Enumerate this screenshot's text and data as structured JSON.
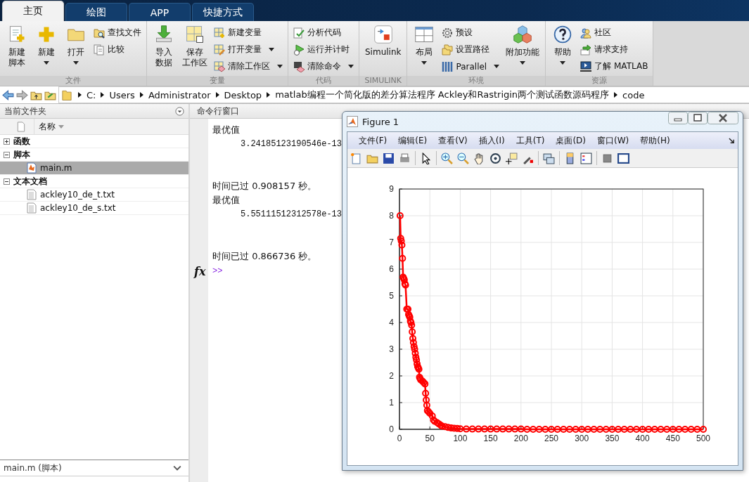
{
  "tabs": [
    {
      "label": "主页",
      "selected": true
    },
    {
      "label": "绘图",
      "selected": false
    },
    {
      "label": "APP",
      "selected": false
    },
    {
      "label": "快捷方式",
      "selected": false
    }
  ],
  "ribbon": {
    "groups": [
      {
        "label": "文件",
        "columns": [
          [
            {
              "kind": "large",
              "lines": [
                "新建",
                "脚本"
              ],
              "dropdown": false
            }
          ],
          [
            {
              "kind": "large",
              "lines": [
                "新建"
              ],
              "dropdown": true
            }
          ],
          [
            {
              "kind": "large",
              "lines": [
                "打开"
              ],
              "dropdown": true
            }
          ],
          [
            {
              "kind": "small",
              "lines": [
                "查找文件"
              ],
              "dropdown": false
            },
            {
              "kind": "small",
              "lines": [
                "比较"
              ],
              "dropdown": false
            }
          ]
        ]
      },
      {
        "label": "变量",
        "columns": [
          [
            {
              "kind": "large",
              "lines": [
                "导入",
                "数据"
              ],
              "dropdown": false
            }
          ],
          [
            {
              "kind": "large",
              "lines": [
                "保存",
                "工作区"
              ],
              "dropdown": false
            }
          ],
          [
            {
              "kind": "small",
              "lines": [
                "新建变量"
              ],
              "dropdown": false
            },
            {
              "kind": "small",
              "lines": [
                "打开变量"
              ],
              "dropdown": true
            },
            {
              "kind": "small",
              "lines": [
                "清除工作区"
              ],
              "dropdown": true
            }
          ]
        ]
      },
      {
        "label": "代码",
        "columns": [
          [
            {
              "kind": "small",
              "lines": [
                "分析代码"
              ],
              "dropdown": false
            },
            {
              "kind": "small",
              "lines": [
                "运行并计时"
              ],
              "dropdown": false
            },
            {
              "kind": "small",
              "lines": [
                "清除命令"
              ],
              "dropdown": true
            }
          ]
        ]
      },
      {
        "label": "SIMULINK",
        "columns": [
          [
            {
              "kind": "large",
              "lines": [
                "Simulink"
              ],
              "dropdown": false
            }
          ]
        ]
      },
      {
        "label": "环境",
        "columns": [
          [
            {
              "kind": "large",
              "lines": [
                "布局"
              ],
              "dropdown": true
            }
          ],
          [
            {
              "kind": "small",
              "lines": [
                "预设"
              ],
              "dropdown": false
            },
            {
              "kind": "small",
              "lines": [
                "设置路径"
              ],
              "dropdown": false
            },
            {
              "kind": "small",
              "lines": [
                "Parallel"
              ],
              "dropdown": true
            }
          ],
          [
            {
              "kind": "large",
              "lines": [
                "附加功能"
              ],
              "dropdown": true
            }
          ]
        ]
      },
      {
        "label": "资源",
        "columns": [
          [
            {
              "kind": "large",
              "lines": [
                "帮助"
              ],
              "dropdown": true
            }
          ],
          [
            {
              "kind": "small",
              "lines": [
                "社区"
              ],
              "dropdown": false
            },
            {
              "kind": "small",
              "lines": [
                "请求支持"
              ],
              "dropdown": false
            },
            {
              "kind": "small",
              "lines": [
                "了解 MATLAB"
              ],
              "dropdown": false
            }
          ]
        ]
      }
    ]
  },
  "address_bar": {
    "crumbs": [
      "C:",
      "Users",
      "Administrator",
      "Desktop",
      "matlab编程一个简化版的差分算法程序 Ackley和Rastrigin两个测试函数源码程序",
      "code"
    ]
  },
  "file_panel": {
    "title": "当前文件夹",
    "column": "名称",
    "tree": [
      {
        "label": "函数",
        "kind": "folder",
        "expanded": false,
        "selected": false
      },
      {
        "label": "脚本",
        "kind": "folder",
        "expanded": true,
        "selected": false,
        "children": [
          {
            "label": "main.m",
            "kind": "mfile",
            "selected": true
          }
        ]
      },
      {
        "label": "文本文档",
        "kind": "folder",
        "expanded": true,
        "selected": false,
        "children": [
          {
            "label": "ackley10_de_t.txt",
            "kind": "text",
            "selected": false
          },
          {
            "label": "ackley10_de_s.txt",
            "kind": "text",
            "selected": false
          }
        ]
      }
    ],
    "details": "main.m  (脚本)"
  },
  "command_window": {
    "title": "命令行窗口",
    "lines": [
      {
        "kind": "label",
        "text": "最优值"
      },
      {
        "kind": "value",
        "text": "3.24185123190546e-13"
      },
      {
        "kind": "blank"
      },
      {
        "kind": "blank"
      },
      {
        "kind": "label",
        "text": "时间已过 0.908157 秒。"
      },
      {
        "kind": "label",
        "text": "最优值"
      },
      {
        "kind": "value",
        "text": "5.55111512312578e-13"
      },
      {
        "kind": "blank"
      },
      {
        "kind": "blank"
      },
      {
        "kind": "label",
        "text": "时间已过 0.866736 秒。"
      }
    ],
    "fx": "fx",
    "prompt": ">>"
  },
  "figure": {
    "title": "Figure 1",
    "menu": [
      "文件(F)",
      "编辑(E)",
      "查看(V)",
      "插入(I)",
      "工具(T)",
      "桌面(D)",
      "窗口(W)",
      "帮助(H)"
    ],
    "chart_data": {
      "type": "line",
      "x": [
        1,
        2,
        3,
        4,
        5,
        6,
        7,
        8,
        9,
        10,
        12,
        14,
        15,
        16,
        17,
        18,
        19,
        20,
        21,
        22,
        23,
        24,
        25,
        26,
        27,
        28,
        29,
        30,
        31,
        32,
        33,
        34,
        35,
        38,
        40,
        42,
        43,
        44,
        45,
        46,
        48,
        50,
        54,
        56,
        58,
        62,
        65,
        68,
        70,
        75,
        80,
        85,
        90,
        95,
        100,
        110,
        120,
        130,
        140,
        150,
        160,
        170,
        180,
        190,
        200,
        210,
        220,
        230,
        240,
        250,
        260,
        270,
        280,
        290,
        300,
        310,
        320,
        330,
        340,
        350,
        360,
        370,
        380,
        390,
        400,
        410,
        420,
        430,
        440,
        450,
        460,
        470,
        480,
        490,
        500
      ],
      "grid": true,
      "series": [
        {
          "color": "#ff0000",
          "marker": "o",
          "values": [
            8.0,
            7.15,
            7.05,
            6.9,
            6.4,
            5.7,
            5.65,
            5.6,
            5.45,
            5.4,
            4.5,
            4.5,
            4.3,
            4.25,
            4.2,
            4.05,
            4.0,
            3.9,
            3.65,
            3.4,
            3.25,
            3.1,
            3.0,
            2.85,
            2.7,
            2.6,
            2.45,
            2.35,
            2.3,
            2.25,
            1.95,
            1.9,
            1.85,
            1.8,
            1.75,
            1.7,
            1.35,
            1.1,
            0.9,
            0.7,
            0.65,
            0.6,
            0.5,
            0.35,
            0.3,
            0.25,
            0.2,
            0.15,
            0.12,
            0.1,
            0.07,
            0.05,
            0.04,
            0.03,
            0.02,
            0.01,
            0.01,
            0.01,
            0.01,
            0.01,
            0.01,
            0.01,
            0.01,
            0.01,
            0.01,
            0,
            0,
            0,
            0,
            0,
            0,
            0,
            0,
            0,
            0,
            0,
            0,
            0,
            0,
            0,
            0,
            0,
            0,
            0,
            0,
            0,
            0,
            0,
            0,
            0,
            0,
            0,
            0,
            0,
            0
          ]
        }
      ],
      "xlim": [
        0,
        500
      ],
      "ylim": [
        0,
        9
      ],
      "xticks": [
        0,
        50,
        100,
        150,
        200,
        250,
        300,
        350,
        400,
        450,
        500
      ],
      "yticks": [
        0,
        1,
        2,
        3,
        4,
        5,
        6,
        7,
        8,
        9
      ]
    }
  }
}
